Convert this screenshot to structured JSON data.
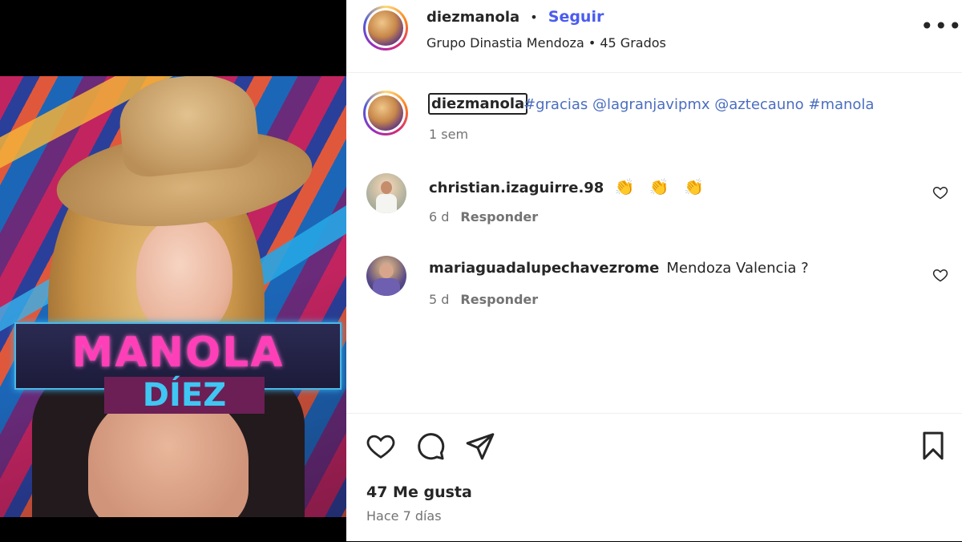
{
  "media": {
    "overlay_title": "MANOLA",
    "overlay_subtitle": "DÍEZ"
  },
  "header": {
    "username": "diezmanola",
    "separator": "•",
    "follow_label": "Seguir",
    "subtitle": "Grupo Dinastia Mendoza • 45 Grados",
    "more_icon": "more-horizontal-icon"
  },
  "caption": {
    "username": "diezmanola",
    "text": "#gracias @lagranjavipmx @aztecauno #manola",
    "time": "1 sem"
  },
  "comments": [
    {
      "username": "christian.izaguirre.98",
      "text": "👏 👏 👏",
      "time": "6 d",
      "reply_label": "Responder"
    },
    {
      "username": "mariaguadalupechavezrome",
      "text": "Mendoza Valencia ?",
      "time": "5 d",
      "reply_label": "Responder"
    }
  ],
  "footer": {
    "likes": "47 Me gusta",
    "posted": "Hace 7 días",
    "icons": [
      "heart-icon",
      "comment-icon",
      "share-icon",
      "bookmark-icon"
    ]
  },
  "colors": {
    "link_blue": "#4a5cf0",
    "hashtag_blue": "#4a6ec0",
    "muted": "#737373",
    "overlay_pink": "#ff3fb7",
    "overlay_cyan": "#3fc6f2"
  }
}
